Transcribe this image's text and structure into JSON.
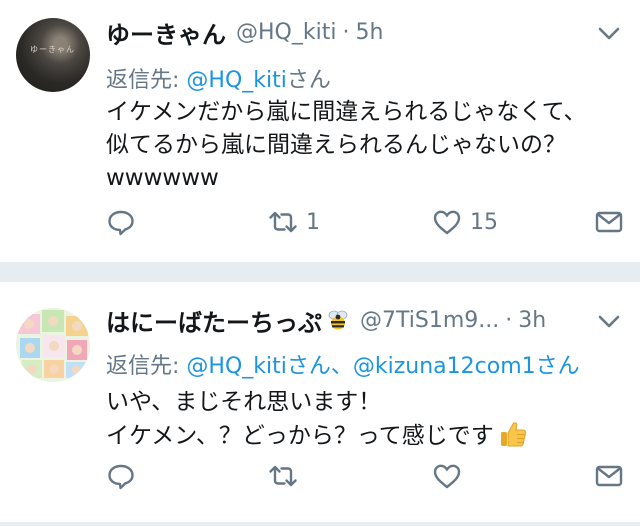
{
  "tweets": [
    {
      "name": "ゆーきゃん",
      "handle": "@HQ_kiti",
      "separator": "·",
      "time": "5h",
      "reply_label": "返信先: ",
      "reply_mentions": [
        "@HQ_kiti"
      ],
      "reply_suffix": "さん",
      "body_lines": [
        "イケメンだから嵐に間違えられるじゃなくて、",
        "似てるから嵐に間違えられるんじゃないの？",
        "wwwwww"
      ],
      "actions": {
        "reply_count": "",
        "retweet_count": "1",
        "like_count": "15"
      },
      "avatar_text": "ゆーきゃん"
    },
    {
      "name": "はにーばたーちっぷ",
      "handle": "@7TiS1m9...",
      "separator": "·",
      "time": "3h",
      "reply_label": "返信先: ",
      "reply_mentions": [
        "@HQ_kiti",
        "@kizuna12com1"
      ],
      "reply_joiner": "さん、",
      "reply_suffix": "さん",
      "body_lines": [
        "いや、まじそれ思います！",
        "イケメン、？どっから？って感じです"
      ],
      "actions": {
        "reply_count": "",
        "retweet_count": "",
        "like_count": ""
      }
    }
  ],
  "colors": {
    "text": "#14171a",
    "secondary": "#657786",
    "link": "#1b95e0",
    "divider": "#e6ecf0"
  },
  "icons": [
    "reply-icon",
    "retweet-icon",
    "like-icon",
    "direct-message-icon",
    "chevron-down-icon",
    "bee-emoji",
    "thumbs-up-emoji"
  ]
}
